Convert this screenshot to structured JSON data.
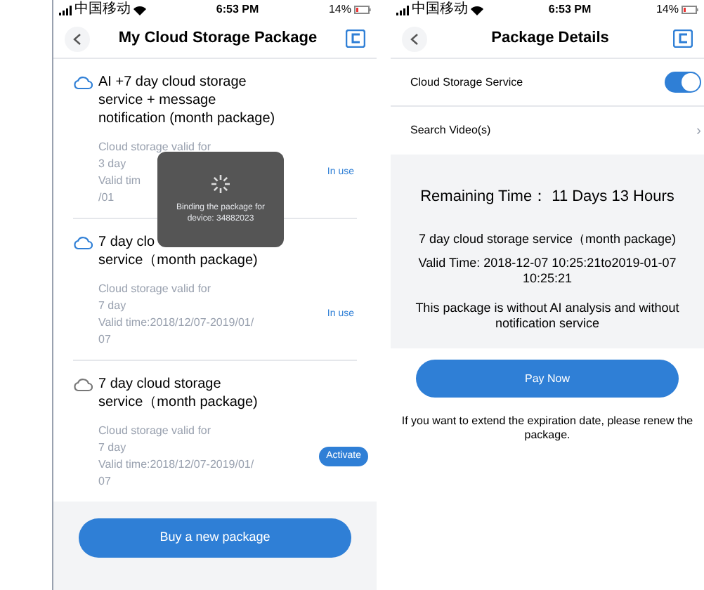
{
  "screens": [
    {
      "status_bar": {
        "carrier": "中国移动",
        "time": "6:53 PM",
        "battery": "14%"
      },
      "nav": {
        "title": "My Cloud Storage Package"
      },
      "packages": [
        {
          "title_lines": [
            "AI +7 day cloud storage",
            "service + message",
            "notification (month package)"
          ],
          "lines": [
            "Cloud storage valid for",
            "3 day",
            "Valid tim",
            "/01"
          ],
          "kind": "in_use",
          "status": "In use"
        },
        {
          "title_lines": [
            "7 day clo",
            "service（month package)"
          ],
          "lines": [
            "Cloud storage valid for",
            "7 day",
            "Valid time:2018/12/07-2019/01/",
            "07"
          ],
          "kind": "in_use",
          "status": "In use"
        },
        {
          "title_lines": [
            "7 day cloud storage",
            "service（month package)"
          ],
          "lines": [
            "Cloud storage valid for",
            "7 day",
            "Valid time:2018/12/07-2019/01/",
            "07"
          ],
          "kind": "inactive",
          "status": "Activate"
        }
      ],
      "toast": {
        "text": "Binding the package for device: 34882023"
      },
      "button": "Buy a new package"
    },
    {
      "status_bar": {
        "carrier": "中国移动",
        "time": "6:53 PM",
        "battery": "14%"
      },
      "nav": {
        "title": "Package Details"
      },
      "settings": [
        {
          "kind": "toggle",
          "label": "Cloud Storage Service",
          "on": true
        },
        {
          "kind": "link",
          "label": "Search Video(s)",
          "chevron": "›"
        }
      ],
      "remaining": "Remaining Time：  11 Days 13 Hours",
      "details": [
        "7 day cloud storage service（month package)",
        "Valid Time: 2018-12-07 10:25:21to2019-01-07 10:25:21",
        "This package is without AI analysis and without notification service"
      ],
      "button": "Pay Now",
      "note": "If you want to extend the expiration date, please renew the package."
    }
  ]
}
